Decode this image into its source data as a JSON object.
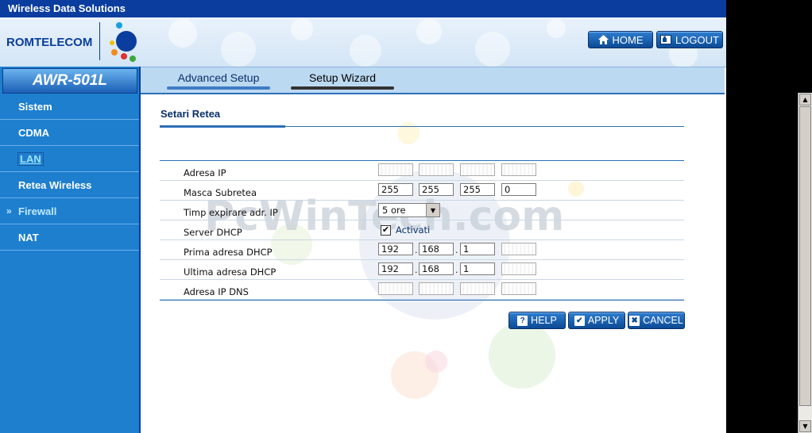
{
  "titlebar": {
    "title": "Wireless Data Solutions"
  },
  "brand": {
    "name": "ROMTELECOM"
  },
  "header": {
    "home_label": "HOME",
    "logout_label": "LOGOUT"
  },
  "sidebar": {
    "model": "AWR-501L",
    "items": [
      {
        "label": "Sistem"
      },
      {
        "label": "CDMA"
      },
      {
        "label": "LAN"
      },
      {
        "label": "Retea Wireless"
      },
      {
        "label": "Firewall"
      },
      {
        "label": "NAT"
      }
    ],
    "arrow": "»"
  },
  "tabs": {
    "advanced": "Advanced Setup",
    "wizard": "Setup Wizard"
  },
  "section": {
    "title": "Setari Retea"
  },
  "form": {
    "ip_label": "Adresa IP",
    "mask_label": "Masca Subretea",
    "mask": [
      "255",
      "255",
      "255",
      "0"
    ],
    "lease_label": "Timp expirare adr. IP",
    "lease_value": "5 ore",
    "dhcp_label": "Server DHCP",
    "dhcp_checked": "✔",
    "dhcp_value": "Activati",
    "first_label": "Prima adresa DHCP",
    "first": [
      "192",
      "168",
      "1",
      ""
    ],
    "last_label": "Ultima adresa DHCP",
    "last": [
      "192",
      "168",
      "1",
      ""
    ],
    "dns_label": "Adresa IP DNS",
    "sep": "."
  },
  "actions": {
    "help": "HELP",
    "apply": "APPLY",
    "cancel": "CANCEL"
  },
  "watermark": "PcWinTech.com",
  "colors": {
    "primary": "#0a3d9e",
    "sidebar": "#1e7fcf",
    "button": "#0c4a95"
  }
}
